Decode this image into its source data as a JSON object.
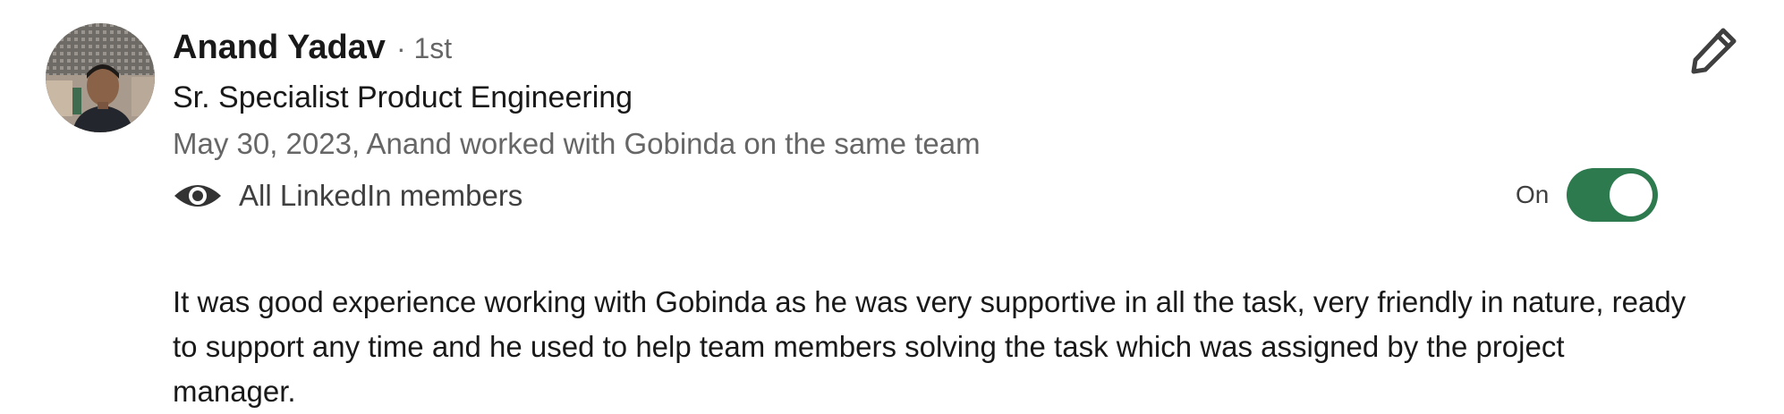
{
  "recommendation": {
    "author_name": "Anand Yadav",
    "connection_degree": "· 1st",
    "headline": "Sr. Specialist Product Engineering",
    "meta": "May 30, 2023, Anand worked with Gobinda on the same team",
    "visibility_label": "All LinkedIn members",
    "visibility_icon": "eye-icon",
    "toggle_label": "On",
    "toggle_state": true,
    "edit_icon": "pencil-icon",
    "text": "It was good experience working with Gobinda as he was very supportive in all the task, very friendly in nature, ready to support any time and he used to help team members solving the task which was assigned by the project manager."
  },
  "colors": {
    "toggle_on": "#2d7a4f",
    "primary_text": "#191919",
    "secondary_text": "#666666"
  }
}
